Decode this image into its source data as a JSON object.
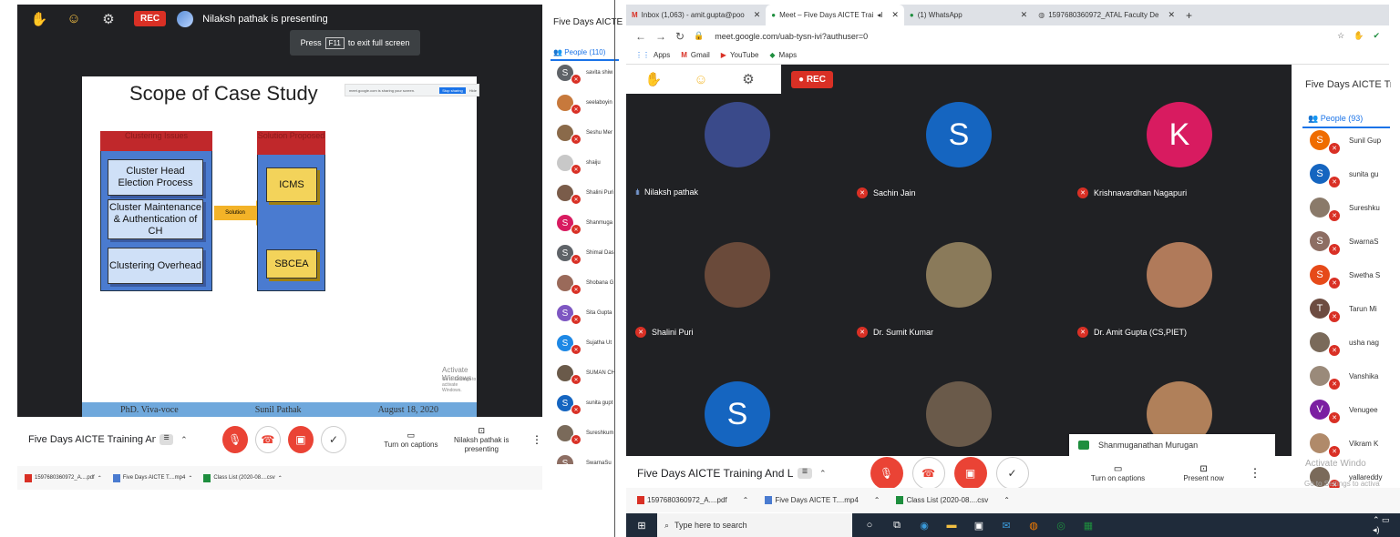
{
  "left": {
    "presenting_text": "Nilaksh pathak is presenting",
    "rec_label": "REC",
    "fullscreen": {
      "press": "Press",
      "key": "F11",
      "rest": "to exit full screen"
    },
    "slide": {
      "title": "Scope of Case Study",
      "share_notice": "meet.google.com is sharing your screen.",
      "stop_sharing": "Stop sharing",
      "hide": "Hide",
      "left_head": "Clustering Issues",
      "right_head": "Solution Proposed",
      "cells": [
        "Cluster Head Election Process",
        "Cluster Maintenance & Authentication of CH",
        "Clustering Overhead"
      ],
      "arrow_label": "Solution",
      "solutions": [
        "ICMS",
        "SBCEA"
      ],
      "footer": [
        "PhD. Viva-voce",
        "Sunil Pathak",
        "August 18, 2020"
      ],
      "activate1": "Activate Windows",
      "activate2": "Go to Settings to activate Windows."
    },
    "meeting_name": "Five Days AICTE Training And L...",
    "captions_label": "Turn on captions",
    "presenting_label": "Nilaksh pathak is presenting",
    "people_panel": {
      "title": "Five Days AICTE Tra",
      "tab": "People (110)",
      "people": [
        {
          "name": "savita shiw",
          "initial": "S",
          "color": "#5f6368"
        },
        {
          "name": "seelaboyin",
          "initial": "",
          "color": "#c7793c"
        },
        {
          "name": "Seshu Mer",
          "initial": "",
          "color": "#8a6a4a"
        },
        {
          "name": "shaiju",
          "initial": "",
          "color": "#c8c8c8"
        },
        {
          "name": "Shalini Puri",
          "initial": "",
          "color": "#7a5c4a"
        },
        {
          "name": "Shanmuga",
          "initial": "S",
          "color": "#d81b60"
        },
        {
          "name": "Shimal Das",
          "initial": "S",
          "color": "#5f6368"
        },
        {
          "name": "Shobana G",
          "initial": "",
          "color": "#9a6a5a"
        },
        {
          "name": "Sita Gupta",
          "initial": "S",
          "color": "#7e57c2"
        },
        {
          "name": "Sujatha Ut",
          "initial": "S",
          "color": "#1e88e5"
        },
        {
          "name": "SUMAN CH",
          "initial": "",
          "color": "#6a5a4a"
        },
        {
          "name": "sunita gupt",
          "initial": "S",
          "color": "#1565c0"
        },
        {
          "name": "Sureshkum",
          "initial": "",
          "color": "#7a6a5a"
        },
        {
          "name": "SwarnaSu",
          "initial": "S",
          "color": "#8d6e63"
        }
      ]
    },
    "downloads": [
      "1597680360972_A....pdf",
      "Five Days AICTE T....mp4",
      "Class List (2020-08....csv"
    ]
  },
  "right": {
    "tabs": [
      {
        "label": "Inbox (1,063) - amit.gupta@poo",
        "icon": "gmail-icon"
      },
      {
        "label": "Meet – Five Days AICTE Trai",
        "icon": "meet-icon"
      },
      {
        "label": "(1) WhatsApp",
        "icon": "whatsapp-icon"
      },
      {
        "label": "1597680360972_ATAL Faculty De",
        "icon": "globe-icon"
      }
    ],
    "url": "meet.google.com/uab-tysn-ivi?authuser=0",
    "bookmarks": [
      "Apps",
      "Gmail",
      "YouTube",
      "Maps"
    ],
    "rec_label": "REC",
    "tiles": [
      {
        "name": "Nilaksh pathak",
        "initial": "",
        "color": "#3a4a8a",
        "muted": false
      },
      {
        "name": "Sachin Jain",
        "initial": "S",
        "color": "#1565c0",
        "muted": true
      },
      {
        "name": "Krishnavardhan Nagapuri",
        "initial": "K",
        "color": "#d81b60",
        "muted": true
      },
      {
        "name": "Shalini Puri",
        "initial": "",
        "color": "#6a4a3a",
        "muted": true
      },
      {
        "name": "Dr. Sumit Kumar",
        "initial": "",
        "color": "#8a7a5a",
        "muted": true
      },
      {
        "name": "Dr. Amit Gupta (CS,PIET)",
        "initial": "",
        "color": "#b07a5a",
        "muted": true
      },
      {
        "name": "",
        "initial": "S",
        "color": "#1565c0",
        "muted": false
      },
      {
        "name": "",
        "initial": "",
        "color": "#6a5a4a",
        "muted": false
      },
      {
        "name": "",
        "initial": "",
        "color": "#b0805a",
        "muted": false
      }
    ],
    "chat_name": "Shanmuganathan Murugan",
    "meeting_name": "Five Days AICTE Training And L...",
    "captions_label": "Turn on captions",
    "present_label": "Present now",
    "people_panel": {
      "title": "Five Days AICTE Tra",
      "tab": "People (93)",
      "people": [
        {
          "name": "Sunil Gup",
          "initial": "S",
          "color": "#ef6c00"
        },
        {
          "name": "sunita gu",
          "initial": "S",
          "color": "#1565c0"
        },
        {
          "name": "Sureshku",
          "initial": "",
          "color": "#8a7a6a"
        },
        {
          "name": "SwarnaS",
          "initial": "S",
          "color": "#8d6e63"
        },
        {
          "name": "Swetha S",
          "initial": "S",
          "color": "#e64a19"
        },
        {
          "name": "Tarun Mi",
          "initial": "T",
          "color": "#6d4c41"
        },
        {
          "name": "usha nag",
          "initial": "",
          "color": "#7a6a5a"
        },
        {
          "name": "Vanshika",
          "initial": "",
          "color": "#9a8a7a"
        },
        {
          "name": "Venugee",
          "initial": "V",
          "color": "#7b1fa2"
        },
        {
          "name": "Vikram K",
          "initial": "",
          "color": "#b08a6a"
        },
        {
          "name": "yallareddy",
          "initial": "",
          "color": "#7a6a5a"
        }
      ]
    },
    "activate1": "Activate Windo",
    "activate2": "Go to Settings to activa",
    "downloads": [
      "1597680360972_A....pdf",
      "Five Days AICTE T....mp4",
      "Class List (2020-08....csv"
    ],
    "search_placeholder": "Type here to search"
  }
}
